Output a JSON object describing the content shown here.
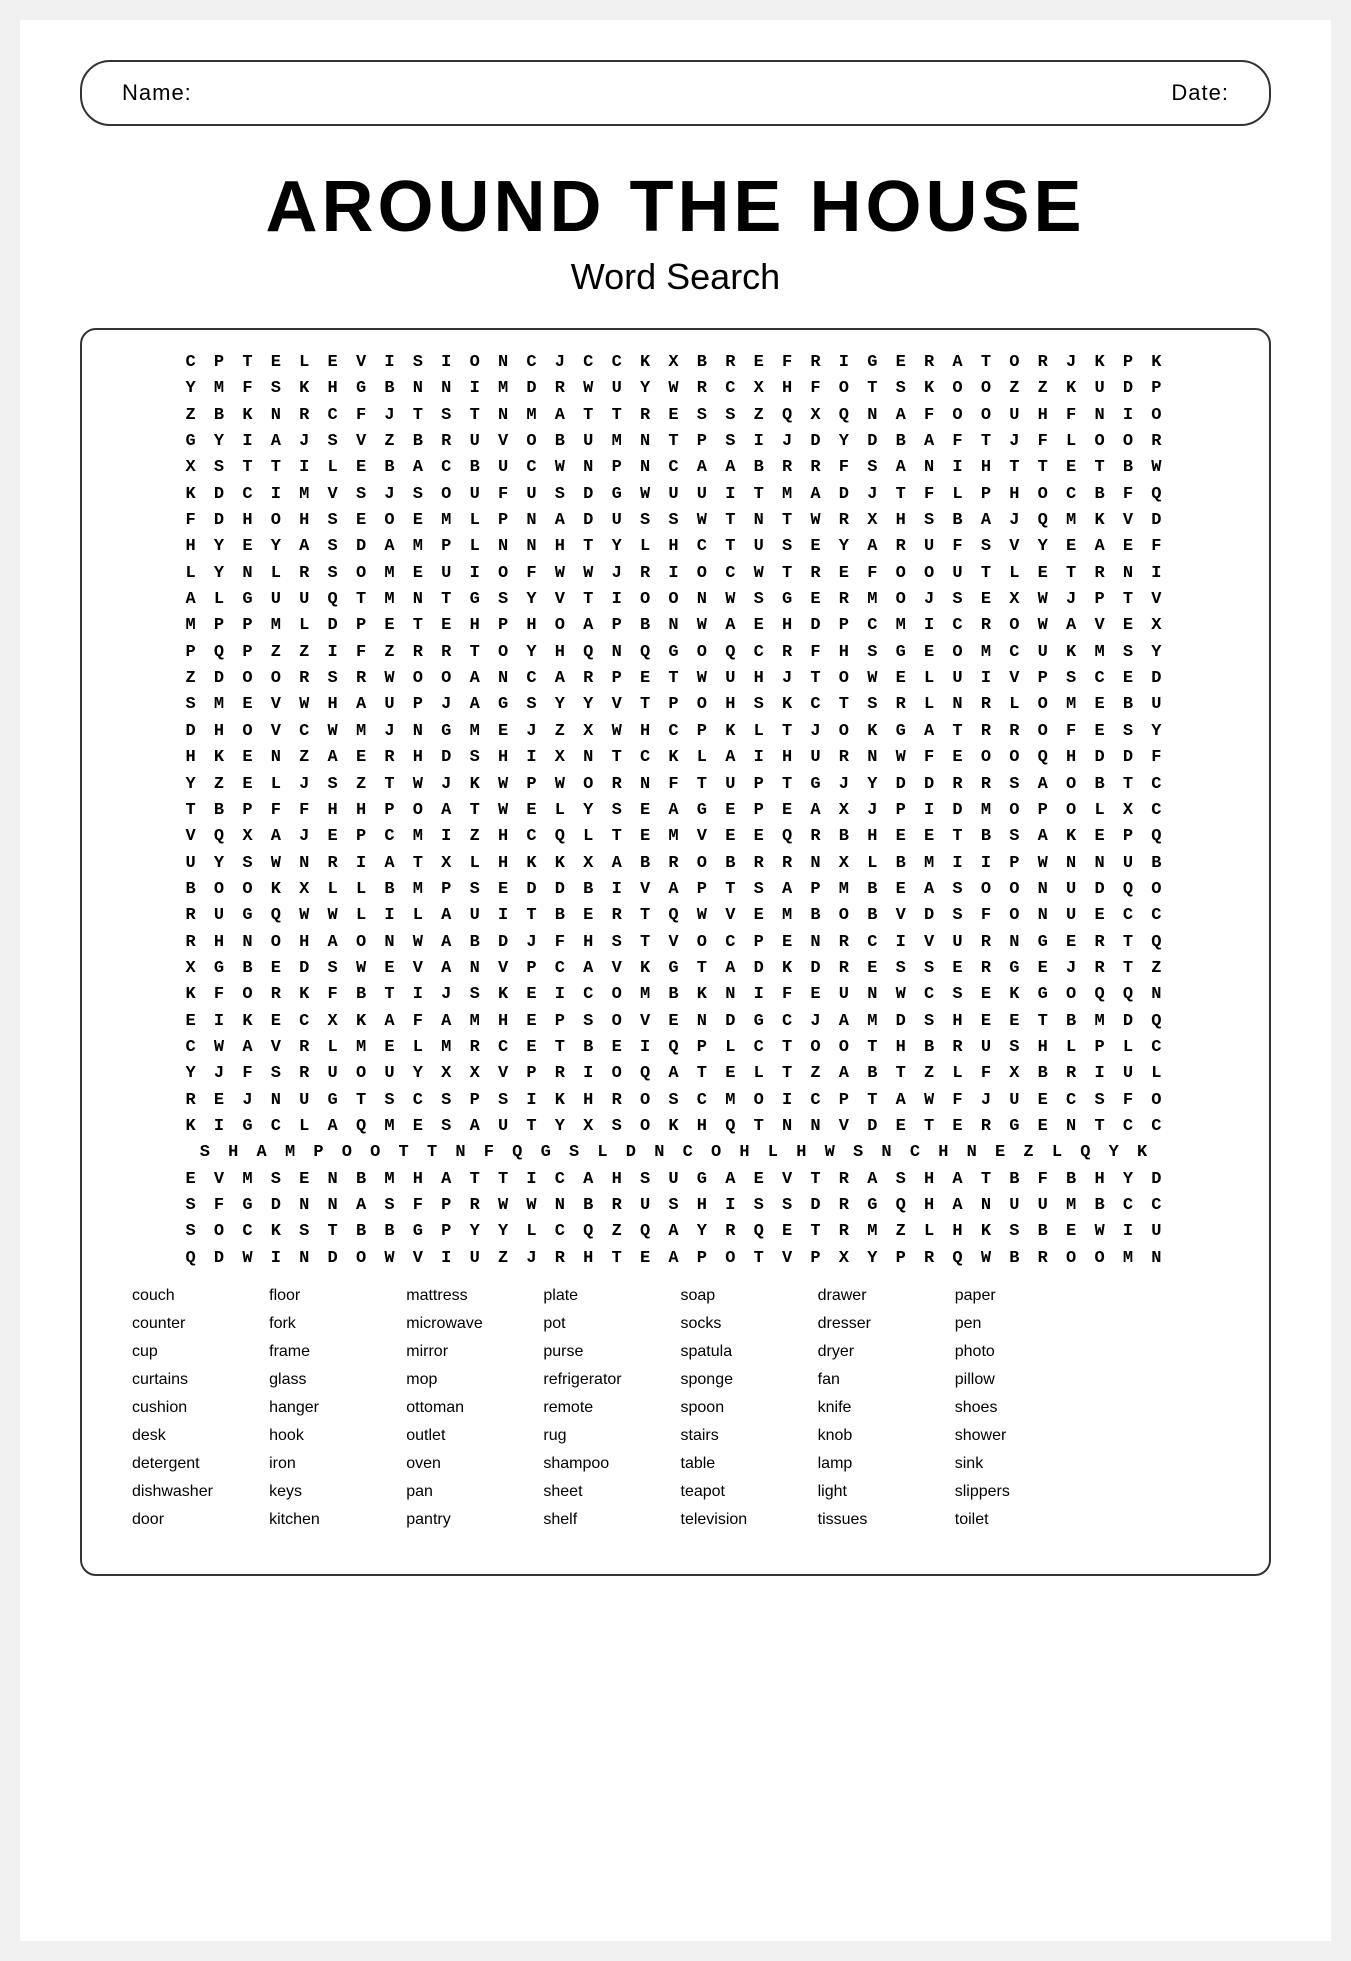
{
  "header": {
    "name_label": "Name:",
    "date_label": "Date:"
  },
  "title": {
    "main": "Around The House",
    "sub": "Word Search"
  },
  "grid": [
    "C P T E L E V I S I O N C J C C K X B R E F R I G E R A T O R J K P K",
    "Y M F S K H G B N N I M D R W U Y W R C X H F O T S K O O Z Z K U D P",
    "Z B K N R C F J T S T N M A T T R E S S Z Q X Q N A F O O U H F N I O",
    "G Y I A J S V Z B R U V O B U M N T P S I J D Y D B A F T J F L O O R",
    "X S T T I L E B A C B U C W N P N C A A B R R F S A N I H T T E T B W",
    "K D C I M V S J S O U F U S D G W U U I T M A D J T F L P H O C B F Q",
    "F D H O H S E O E M L P N A D U S S W T N T W R X H S B A J Q M K V D",
    "H Y E Y A S D A M P L N N H T Y L H C T U S E Y A R U F S V Y E A E F",
    "L Y N L R S O M E U I O F W W J R I O C W T R E F O O U T L E T R N I",
    "A L G U U Q T M N T G S Y V T I O O N W S G E R M O J S E X W J P T V",
    "M P P M L D P E T E H P H O A P B N W A E H D P C M I C R O W A V E X",
    "P Q P Z Z I F Z R R T O Y H Q N Q G O Q C R F H S G E O M C U K M S Y",
    "Z D O O R S R W O O A N C A R P E T W U H J T O W E L U I V P S C E D",
    "S M E V W H A U P J A G S Y Y V T P O H S K C T S R L N R L O M E B U",
    "D H O V C W M J N G M E J Z X W H C P K L T J O K G A T R R O F E S Y",
    "H K E N Z A E R H D S H I X N T C K L A I H U R N W F E O O Q H D D F",
    "Y Z E L J S Z T W J K W P W O R N F T U P T G J Y D D R R S A O B T C",
    "T B P F F H H P O A T W E L Y S E A G E P E A X J P I D M O P O L X C",
    "V Q X A J E P C M I Z H C Q L T E M V E E Q R B H E E T B S A K E P Q",
    "U Y S W N R I A T X L H K K X A B R O B R R N X L B M I I P W N N U B",
    "B O O K X L L B M P S E D D B I V A P T S A P M B E A S O O N U D Q O",
    "R U G Q W W L I L A U I T B E R T Q W V E M B O B V D S F O N U E C C",
    "R H N O H A O N W A B D J F H S T V O C P E N R C I V U R N G E R T Q",
    "X G B E D S W E V A N V P C A V K G T A D K D R E S S E R G E J R T Z",
    "K F O R K F B T I J S K E I C O M B K N I F E U N W C S E K G O Q Q N",
    "E I K E C X K A F A M H E P S O V E N D G C J A M D S H E E T B M D Q",
    "C W A V R L M E L M R C E T B E I Q P L C T O O T H B R U S H L P L C",
    "Y J F S R U O U Y X X V P R I O Q A T E L T Z A B T Z L F X B R I U L",
    "R E J N U G T S C S P S I K H R O S C M O I C P T A W F J U E C S F O",
    "K I G C L A Q M E S A U T Y X S O K H Q T N N V D E T E R G E N T C C",
    "S H A M P O O T T N F Q G S L D N C O H L H W S N C H N E Z L Q Y K",
    "E V M S E N B M H A T T I C A H S U G A E V T R A S H A T B F B H Y D",
    "S F G D N N A S F P R W W N B R U S H I S S D R G Q H A N U U M B C C",
    "S O C K S T B B G P Y Y L C Q Z Q A Y R Q E T R M Z L H K S B E W I U",
    "Q D W I N D O W V I U Z J R H T E A P O T V P X Y P R Q W B R O O M N"
  ],
  "word_columns": [
    [
      "couch",
      "counter",
      "cup",
      "curtains",
      "cushion",
      "desk",
      "detergent",
      "dishwasher",
      "door"
    ],
    [
      "floor",
      "fork",
      "frame",
      "glass",
      "hanger",
      "hook",
      "iron",
      "keys",
      "kitchen"
    ],
    [
      "mattress",
      "microwave",
      "mirror",
      "mop",
      "ottoman",
      "outlet",
      "oven",
      "pan",
      "pantry"
    ],
    [
      "plate",
      "pot",
      "purse",
      "refrigerator",
      "remote",
      "rug",
      "shampoo",
      "sheet",
      "shelf"
    ],
    [
      "soap",
      "socks",
      "spatula",
      "sponge",
      "spoon",
      "stairs",
      "table",
      "teapot",
      "television"
    ],
    [
      "drawer",
      "dresser",
      "dryer",
      "fan",
      "knife",
      "knob",
      "lamp",
      "light",
      "tissues"
    ],
    [
      "paper",
      "pen",
      "photo",
      "pillow",
      "shoes",
      "shower",
      "sink",
      "slippers",
      "toilet"
    ]
  ]
}
